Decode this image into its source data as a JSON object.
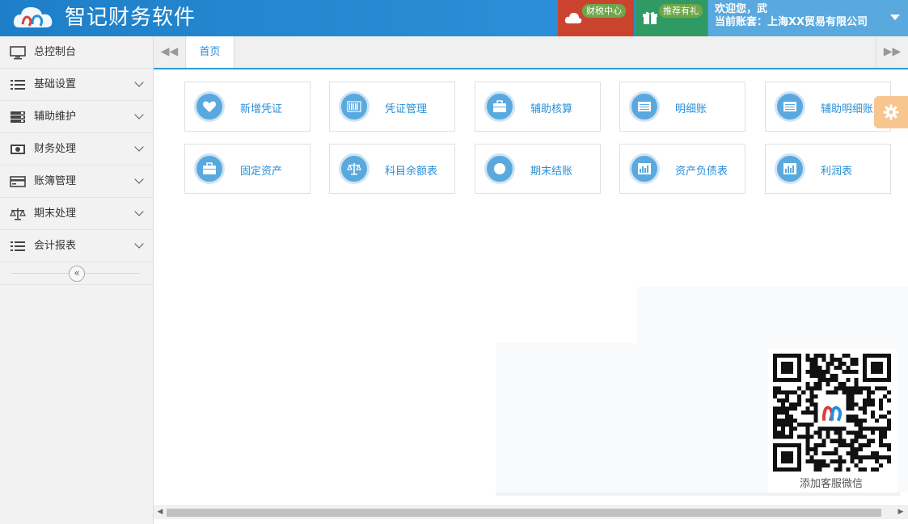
{
  "header": {
    "app_title": "智记财务软件",
    "tax_center_label": "财税中心",
    "referral_label": "推荐有礼",
    "welcome_text": "欢迎您，武",
    "account_text": "当前账套：上海XX贸易有限公司"
  },
  "sidebar": {
    "items": [
      {
        "label": "总控制台",
        "icon": "monitor-icon",
        "expandable": false
      },
      {
        "label": "基础设置",
        "icon": "list-icon",
        "expandable": true
      },
      {
        "label": "辅助维护",
        "icon": "server-icon",
        "expandable": true
      },
      {
        "label": "财务处理",
        "icon": "money-icon",
        "expandable": true
      },
      {
        "label": "账簿管理",
        "icon": "card-icon",
        "expandable": true
      },
      {
        "label": "期末处理",
        "icon": "scale-icon",
        "expandable": true
      },
      {
        "label": "会计报表",
        "icon": "list-icon",
        "expandable": true
      }
    ]
  },
  "tabs": {
    "home": "首页"
  },
  "shortcuts": [
    {
      "label": "新增凭证",
      "icon": "heart-icon"
    },
    {
      "label": "凭证管理",
      "icon": "barcode-icon"
    },
    {
      "label": "辅助核算",
      "icon": "briefcase-icon"
    },
    {
      "label": "明细账",
      "icon": "ledger-icon"
    },
    {
      "label": "辅助明细账",
      "icon": "ledger-icon"
    },
    {
      "label": "固定资产",
      "icon": "briefcase-icon"
    },
    {
      "label": "科目余额表",
      "icon": "scale-icon"
    },
    {
      "label": "期末结账",
      "icon": "circle-icon"
    },
    {
      "label": "资产负债表",
      "icon": "bar-chart-icon"
    },
    {
      "label": "利润表",
      "icon": "bar-chart-icon"
    }
  ],
  "qr": {
    "caption": "添加客服微信"
  },
  "colors": {
    "header_blue": "#2a8fd6",
    "tax_red": "#c9432e",
    "gift_green": "#2f9a64",
    "link_blue": "#2a8fd6",
    "gear_orange": "#f6c68e"
  }
}
